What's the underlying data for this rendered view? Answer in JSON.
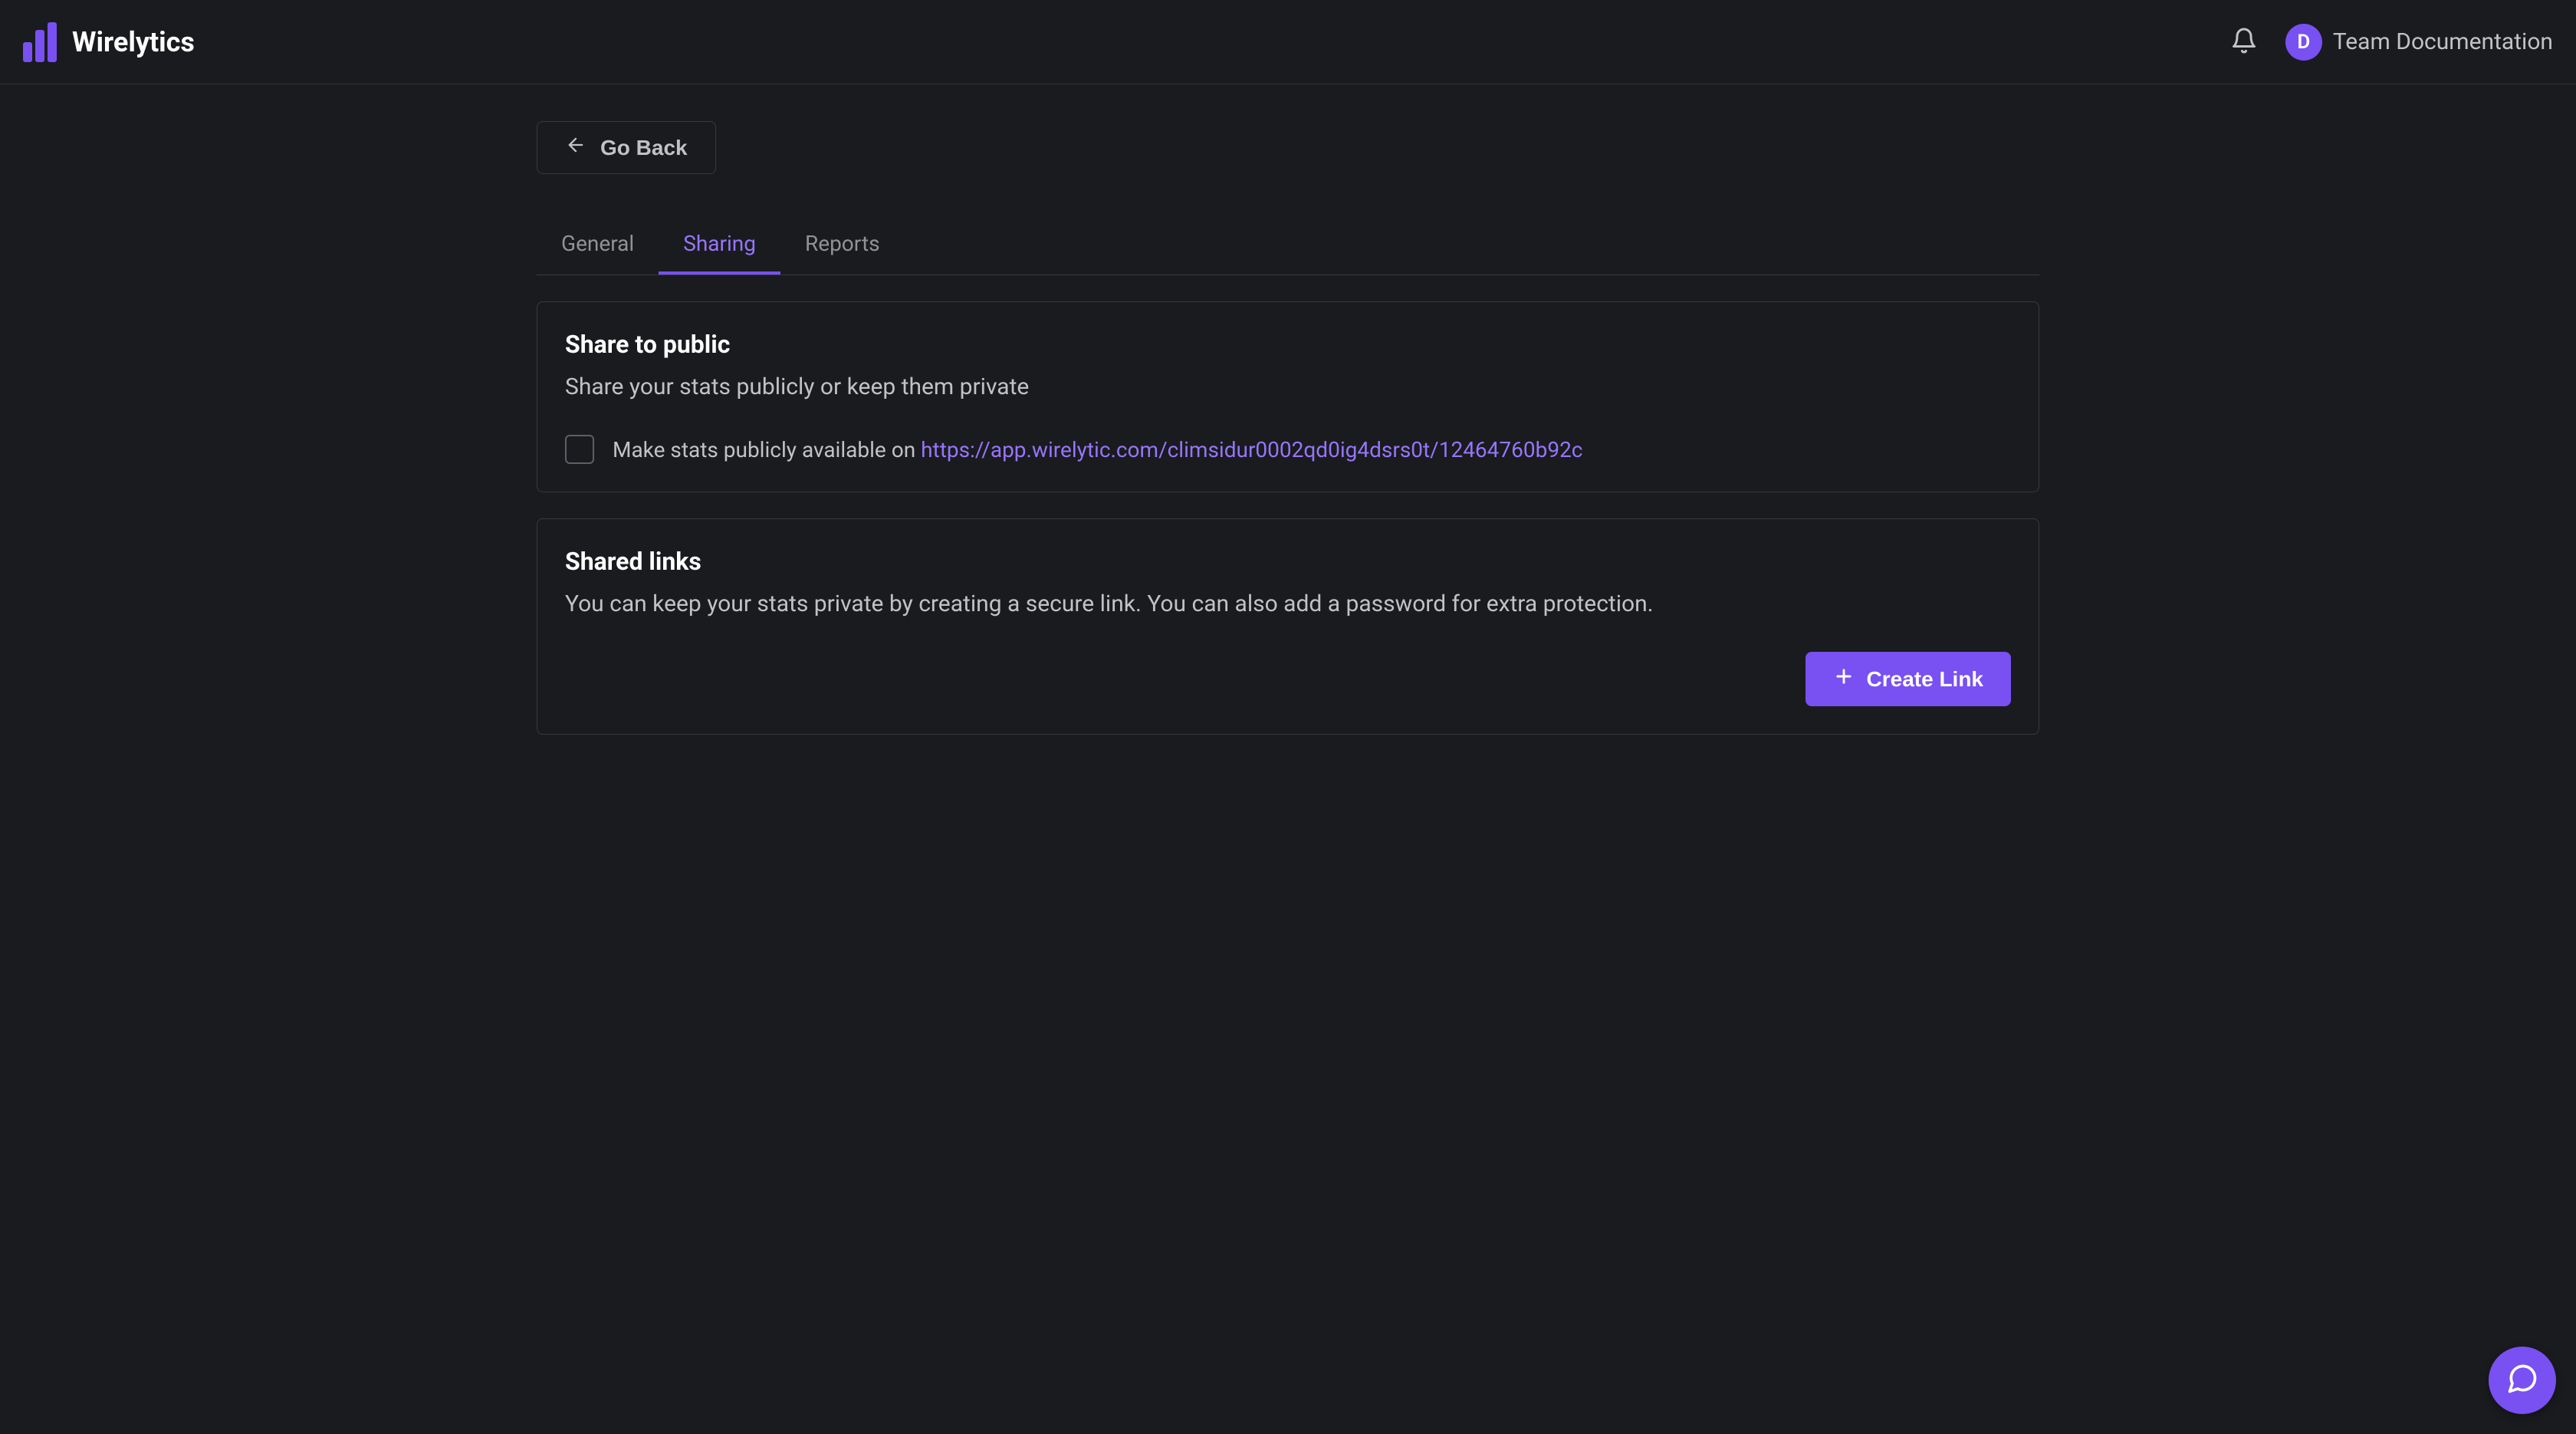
{
  "header": {
    "brand_name": "Wirelytics",
    "team_name": "Team Documentation",
    "avatar_initial": "D"
  },
  "go_back_label": "Go Back",
  "tabs": [
    {
      "label": "General",
      "active": false
    },
    {
      "label": "Sharing",
      "active": true
    },
    {
      "label": "Reports",
      "active": false
    }
  ],
  "share_public": {
    "title": "Share to public",
    "description": "Share your stats publicly or keep them private",
    "checkbox_label_prefix": "Make stats publicly available on ",
    "public_url": "https://app.wirelytic.com/climsidur0002qd0ig4dsrs0t/12464760b92c"
  },
  "shared_links": {
    "title": "Shared links",
    "description": "You can keep your stats private by creating a secure link. You can also add a password for extra protection.",
    "create_link_label": "Create Link"
  },
  "colors": {
    "accent": "#7950f2",
    "accent_light": "#9775fa",
    "background": "#1a1b1e",
    "border": "#373a40"
  }
}
